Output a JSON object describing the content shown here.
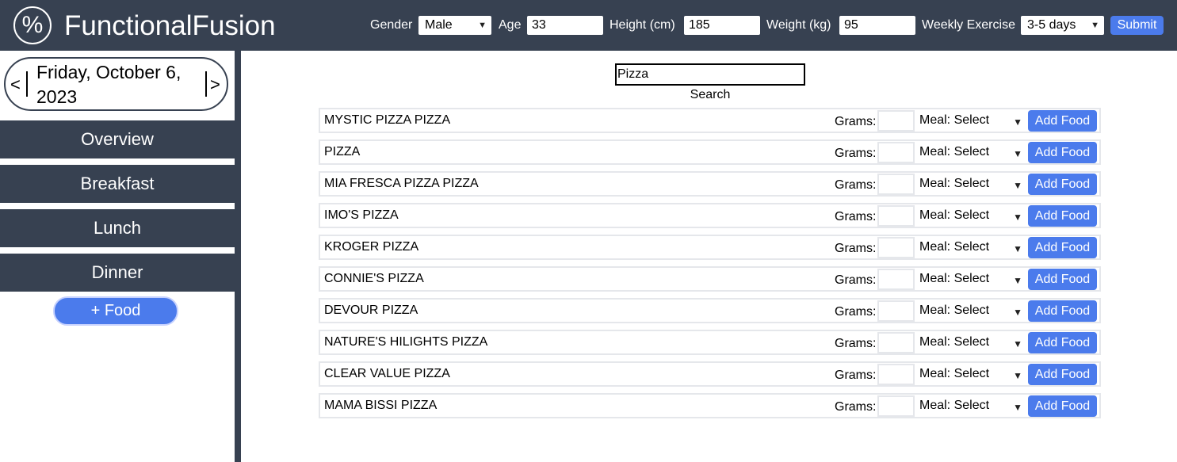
{
  "app": {
    "logo_symbol": "%",
    "title": "FunctionalFusion"
  },
  "profile": {
    "gender_label": "Gender",
    "gender_value": "Male",
    "age_label": "Age",
    "age_value": "33",
    "height_label": "Height (cm)",
    "height_value": "185",
    "weight_label": "Weight (kg)",
    "weight_value": "95",
    "exercise_label": "Weekly Exercise",
    "exercise_value": "3-5 days",
    "submit_label": "Submit"
  },
  "sidebar": {
    "prev": "<",
    "next": ">",
    "date": "Friday, October 6, 2023",
    "items": [
      {
        "label": "Overview"
      },
      {
        "label": "Breakfast"
      },
      {
        "label": "Lunch"
      },
      {
        "label": "Dinner"
      }
    ],
    "add_food_label": "+ Food"
  },
  "search": {
    "value": "Pizza",
    "label": "Search"
  },
  "results": {
    "grams_label": "Grams:",
    "meal_label": "Meal: Select",
    "add_label": "Add Food",
    "items": [
      {
        "name": "MYSTIC PIZZA PIZZA"
      },
      {
        "name": "PIZZA"
      },
      {
        "name": "MIA FRESCA PIZZA PIZZA"
      },
      {
        "name": "IMO'S PIZZA"
      },
      {
        "name": "KROGER PIZZA"
      },
      {
        "name": "CONNIE'S PIZZA"
      },
      {
        "name": "DEVOUR PIZZA"
      },
      {
        "name": "NATURE'S HILIGHTS PIZZA"
      },
      {
        "name": "CLEAR VALUE PIZZA"
      },
      {
        "name": "MAMA BISSI PIZZA"
      }
    ]
  },
  "colors": {
    "header_bg": "#374151",
    "accent": "#4b7bec"
  }
}
